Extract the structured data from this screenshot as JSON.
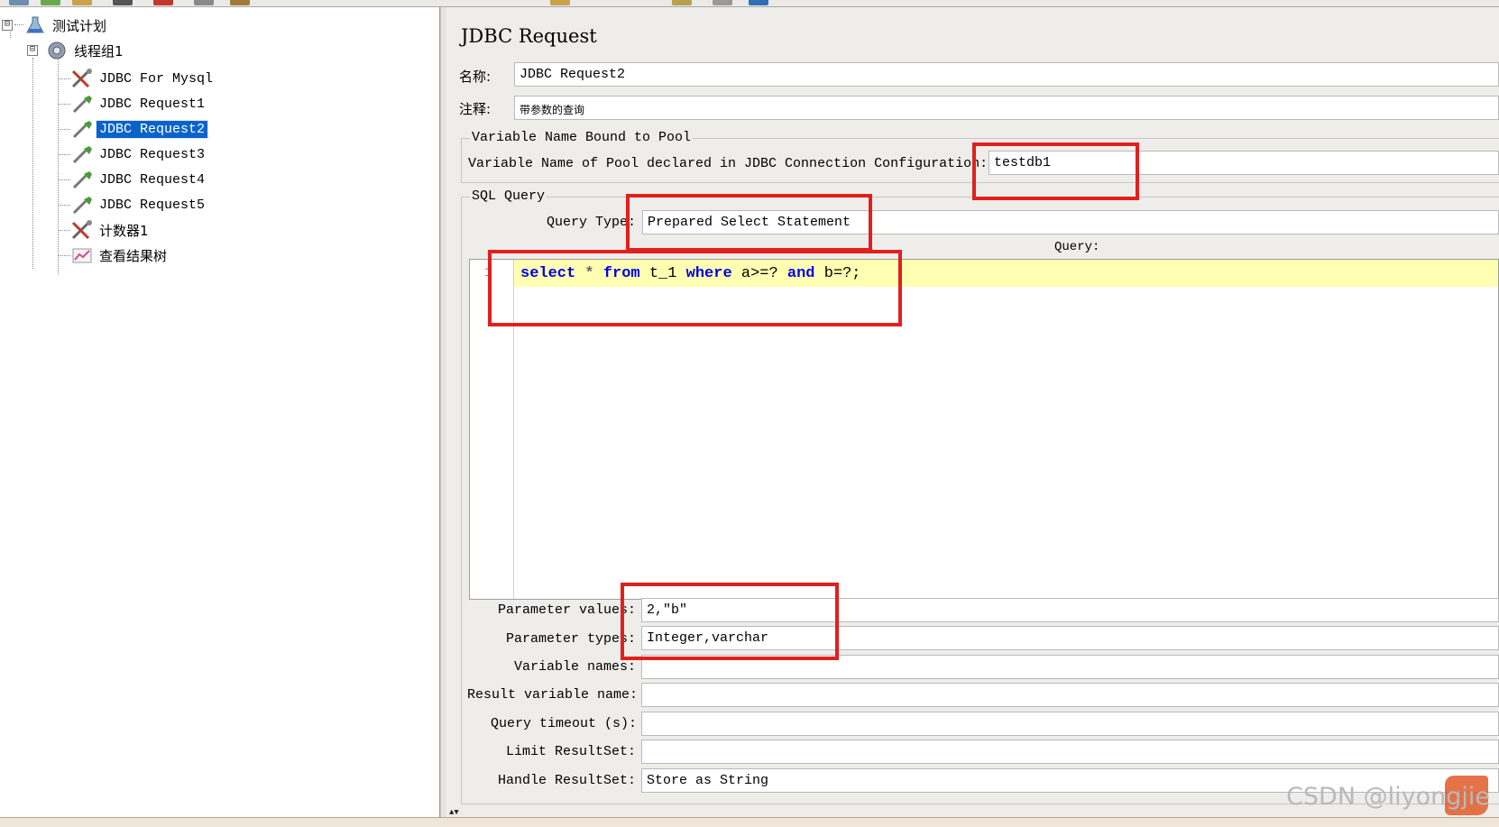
{
  "tree": {
    "root": "测试计划",
    "thread_group": "线程组1",
    "items": [
      {
        "label": "JDBC For Mysql"
      },
      {
        "label": "JDBC Request1"
      },
      {
        "label": "JDBC Request2"
      },
      {
        "label": "JDBC Request3"
      },
      {
        "label": "JDBC Request4"
      },
      {
        "label": "JDBC Request5"
      },
      {
        "label": "计数器1"
      },
      {
        "label": "查看结果树"
      }
    ],
    "expand_glyph": "⊟"
  },
  "panel": {
    "title": "JDBC Request",
    "name_label": "名称:",
    "name_value": "JDBC Request2",
    "comment_label": "注释:",
    "comment_value": "带参数的查询",
    "pool_group_title": "Variable Name Bound to Pool",
    "pool_label": "Variable Name of Pool declared in JDBC Connection Configuration:",
    "pool_value": "testdb1",
    "sql_group_title": "SQL Query",
    "query_type_label": "Query Type:",
    "query_type_value": "Prepared Select Statement",
    "query_label": "Query:",
    "line_number": "1",
    "code": {
      "t1": "select",
      "t2": " * ",
      "t3": "from",
      "t4": " t_1 ",
      "t5": "where",
      "t6": " a>=? ",
      "t7": "and",
      "t8": " b=?;"
    },
    "params": [
      {
        "label": "Parameter values:",
        "value": "2,\"b\""
      },
      {
        "label": "Parameter types:",
        "value": "Integer,varchar"
      },
      {
        "label": "Variable names:",
        "value": ""
      },
      {
        "label": "Result variable name:",
        "value": ""
      },
      {
        "label": "Query timeout (s):",
        "value": ""
      },
      {
        "label": "Limit ResultSet:",
        "value": ""
      },
      {
        "label": "Handle ResultSet:",
        "value": "Store as String"
      }
    ]
  },
  "watermark": "CSDN @liyongjie",
  "colors": {
    "selection": "#0a63c9",
    "annotation_box": "#e0201f",
    "keyword": "#0000e6",
    "current_line": "#ffffb2"
  }
}
